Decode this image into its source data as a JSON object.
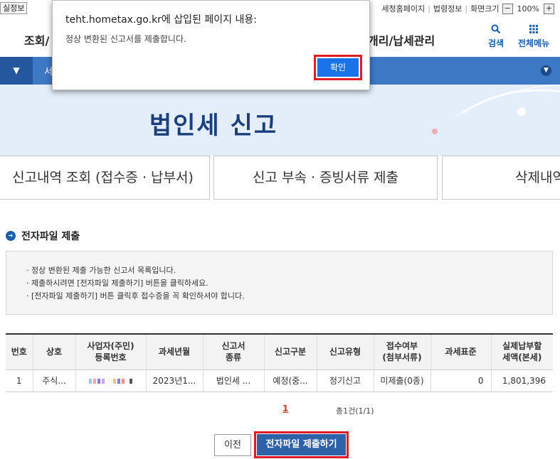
{
  "util": {
    "left_label": "실정보",
    "links": [
      "세청홈페이지",
      "법령정보",
      "화면크기"
    ],
    "zoom_minus": "−",
    "zoom_value": "100%",
    "zoom_plus": "+"
  },
  "header": {
    "menu_left": "조회/",
    "menu_right": "개리/납세관리",
    "search_label": "검색",
    "allmenu_label": "전체메뉴"
  },
  "nav": {
    "fragment": "서"
  },
  "banner": {
    "title": "법인세  신고"
  },
  "tabs": [
    {
      "label": "신고내역 조회 (접수증 · 납부서)"
    },
    {
      "label": "신고 부속 · 증빙서류 제출"
    },
    {
      "label": "삭제내역"
    }
  ],
  "section": {
    "title": "전자파일 제출"
  },
  "info_lines": [
    "· 정상 변환된 제출 가능한 신고서 목록입니다.",
    "· 제출하시려면 [전자파일 제출하기] 버튼을 클릭하세요.",
    "· [전자파일 제출하기] 버튼 클릭후 접수증을 꼭 확인하셔야 합니다."
  ],
  "table": {
    "headers": [
      "번호",
      "상호",
      "사업자(주민)\n등록번호",
      "과세년월",
      "신고서\n종류",
      "신고구분",
      "신고유형",
      "접수여부\n(첨부서류)",
      "과세표준",
      "실제납부할\n세액(본세)"
    ],
    "rows": [
      [
        "1",
        "주식...",
        "",
        "2023년1...",
        "법인세 ...",
        "예정(중...",
        "정기신고",
        "미제출(0종)",
        "0",
        "1,801,396"
      ]
    ]
  },
  "paging": {
    "current": "1",
    "total": "총1건(1/1)"
  },
  "buttons": {
    "prev": "이전",
    "submit": "전자파일 제출하기"
  },
  "dialog": {
    "title": "teht.hometax.go.kr에 삽입된 페이지 내용:",
    "message": "정상 변환된 신고서를 제출합니다.",
    "ok": "확인"
  },
  "colors": {
    "nav_blue": "#3d78c4",
    "banner_bg": "#e3eefa",
    "title_navy": "#1b3f7d",
    "highlight_red": "#e21b2b",
    "dialog_ok_blue": "#1a73e8",
    "submit_blue": "#2d62a8"
  }
}
